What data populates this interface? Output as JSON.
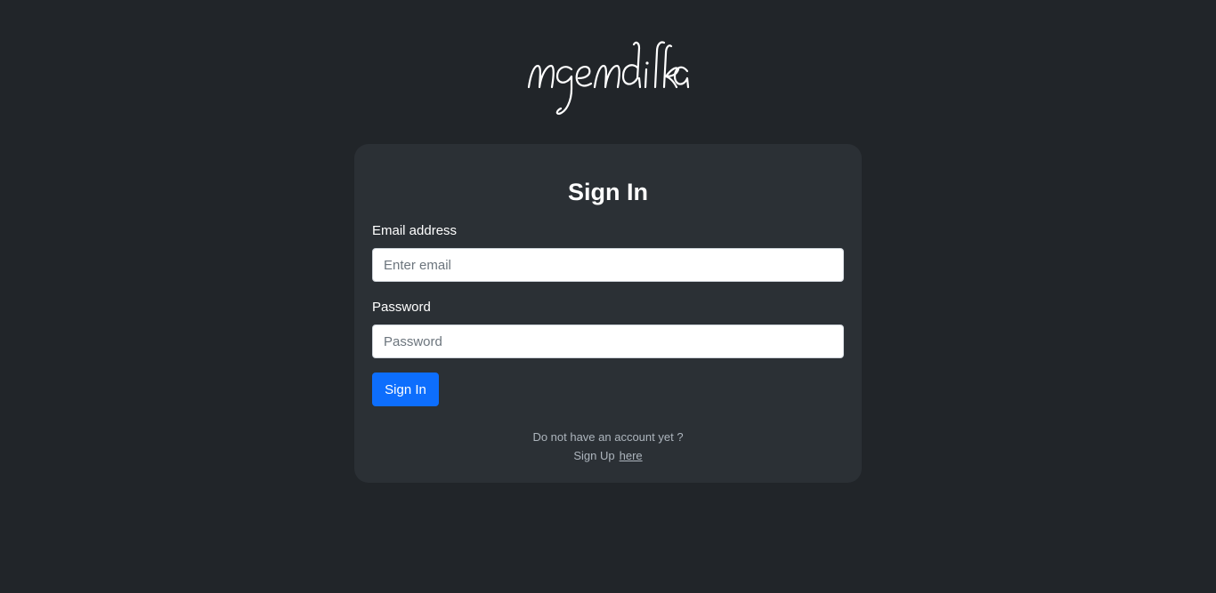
{
  "brand": {
    "logo_text": "ngendika"
  },
  "form": {
    "title": "Sign In",
    "email_label": "Email address",
    "email_placeholder": "Enter email",
    "email_value": "",
    "password_label": "Password",
    "password_placeholder": "Password",
    "password_value": "",
    "submit_label": "Sign In"
  },
  "footer": {
    "question": "Do not have an account yet ?",
    "signup_prefix": "Sign Up",
    "signup_link": "here"
  },
  "colors": {
    "background": "#212529",
    "card": "#2b3035",
    "primary_button": "#0d6efd",
    "muted_text": "#adb5bd"
  }
}
